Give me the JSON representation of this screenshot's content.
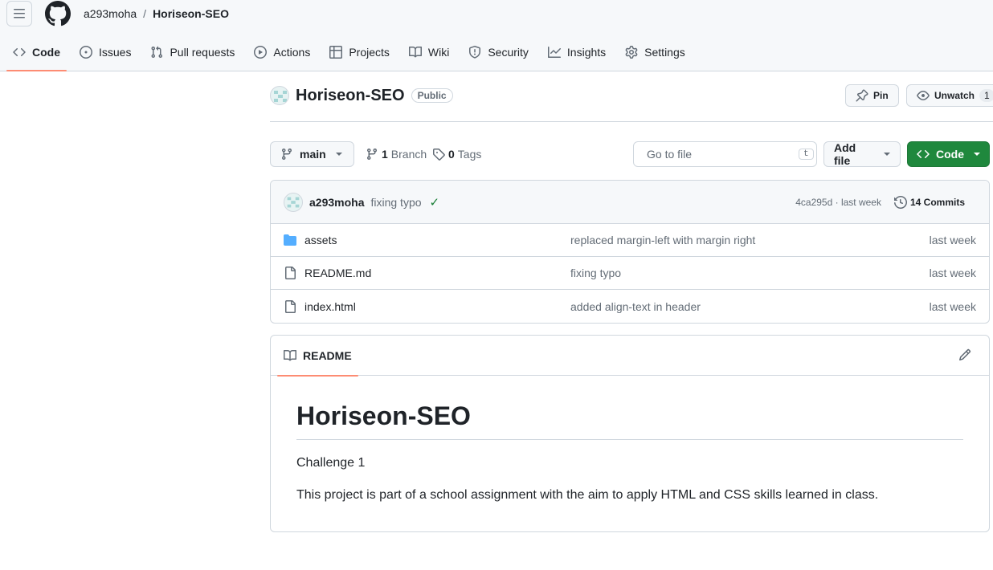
{
  "breadcrumb": {
    "owner": "a293moha",
    "separator": "/",
    "repo": "Horiseon-SEO"
  },
  "nav_tabs": [
    {
      "label": "Code",
      "icon": "code-icon"
    },
    {
      "label": "Issues",
      "icon": "issue-icon"
    },
    {
      "label": "Pull requests",
      "icon": "pull-request-icon"
    },
    {
      "label": "Actions",
      "icon": "play-icon"
    },
    {
      "label": "Projects",
      "icon": "table-icon"
    },
    {
      "label": "Wiki",
      "icon": "book-icon"
    },
    {
      "label": "Security",
      "icon": "shield-icon"
    },
    {
      "label": "Insights",
      "icon": "graph-icon"
    },
    {
      "label": "Settings",
      "icon": "gear-icon"
    }
  ],
  "repo": {
    "name": "Horiseon-SEO",
    "visibility": "Public",
    "pin_label": "Pin",
    "unwatch_label": "Unwatch",
    "watch_count": "1"
  },
  "toolbar": {
    "branch": "main",
    "branches_count": "1",
    "branches_label": "Branch",
    "tags_count": "0",
    "tags_label": "Tags",
    "search_placeholder": "Go to file",
    "search_shortcut": "t",
    "add_file_label": "Add file",
    "code_label": "Code"
  },
  "latest_commit": {
    "author": "a293moha",
    "message": "fixing typo",
    "hash_and_time": "4ca295d · last week",
    "commits_label": "14 Commits"
  },
  "files": [
    {
      "name": "assets",
      "type": "folder",
      "message": "replaced margin-left with margin right",
      "date": "last week"
    },
    {
      "name": "README.md",
      "type": "file",
      "message": "fixing typo",
      "date": "last week"
    },
    {
      "name": "index.html",
      "type": "file",
      "message": "added align-text in header",
      "date": "last week"
    }
  ],
  "readme": {
    "tab_label": "README",
    "heading": "Horiseon-SEO",
    "paragraph_1": "Challenge 1",
    "paragraph_2": "This project is part of a school assignment with the aim to apply HTML and CSS skills learned in class."
  },
  "colors": {
    "accent_underline": "#fd8c73",
    "primary_green": "#1f883d",
    "folder_blue": "#54aeff",
    "check_green": "#1a7f37"
  }
}
